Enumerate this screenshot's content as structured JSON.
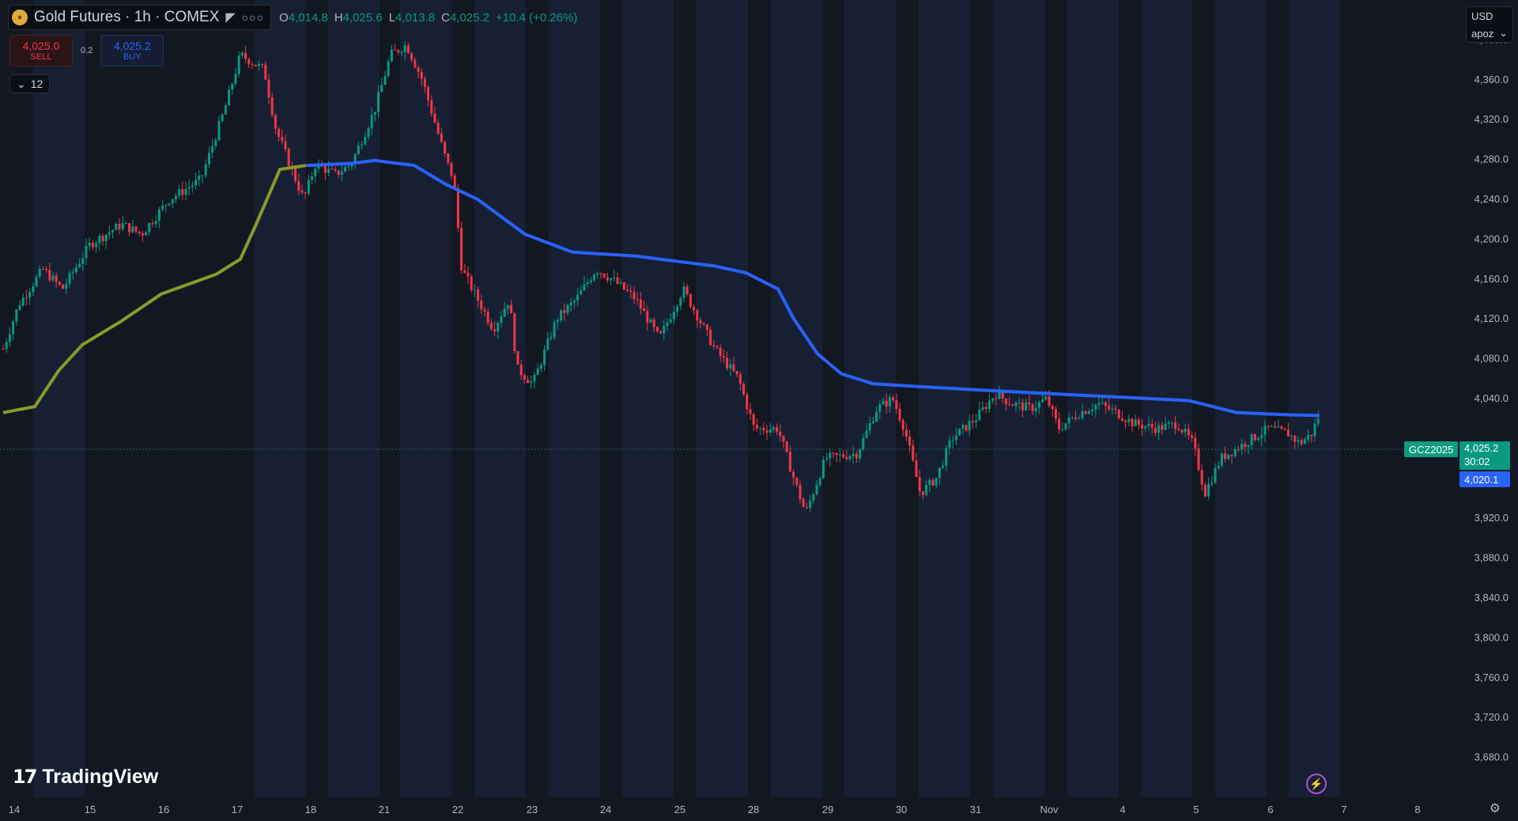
{
  "header": {
    "symbol_title": "Gold Futures · 1h · COMEX",
    "open_label": "O",
    "open": "4,014.8",
    "high_label": "H",
    "high": "4,025.6",
    "low_label": "L",
    "low": "4,013.8",
    "close_label": "C",
    "close": "4,025.2",
    "change": "+10.4 (+0.26%)"
  },
  "trade": {
    "sell_price": "4,025.0",
    "sell_label": "SELL",
    "spread": "0.2",
    "buy_price": "4,025.2",
    "buy_label": "BUY"
  },
  "indicator_toggle": "12",
  "top_right": {
    "currency": "USD",
    "user": "apoz"
  },
  "price_labels": {
    "symbol": "GCZ2025",
    "last_price": "4,025.2",
    "countdown": "30:02",
    "ma_value": "4,020.1"
  },
  "brand": "TradingView",
  "colors": {
    "background": "#131722",
    "session_band": "#172033",
    "up": "#089981",
    "down": "#f23645",
    "ma_slow": "#2962ff",
    "ma_fast": "#8a9a2a"
  },
  "chart_data": {
    "type": "candlestick",
    "interval": "1h",
    "ylim": [
      3640,
      4440
    ],
    "y_ticks": [
      4400,
      4360,
      4320,
      4280,
      4240,
      4200,
      4160,
      4120,
      4080,
      4040,
      3960,
      3920,
      3880,
      3840,
      3800,
      3760,
      3720,
      3680
    ],
    "y_tick_labels": [
      "4,400.0",
      "4,360.0",
      "4,320.0",
      "4,280.0",
      "4,240.0",
      "4,200.0",
      "4,160.0",
      "4,120.0",
      "4,080.0",
      "4,040.0",
      "3,960.0",
      "3,920.0",
      "3,880.0",
      "3,840.0",
      "3,800.0",
      "3,760.0",
      "3,720.0",
      "3,680.0"
    ],
    "x_tick_labels": [
      "14",
      "15",
      "16",
      "17",
      "18",
      "21",
      "22",
      "23",
      "24",
      "25",
      "28",
      "29",
      "30",
      "31",
      "Nov",
      "4",
      "5",
      "6",
      "7",
      "8"
    ],
    "last_price": 4025.2,
    "close_path": {
      "description": "approximate hourly close path read from chart",
      "points": [
        [
          0,
          4090
        ],
        [
          20,
          4135
        ],
        [
          50,
          4170
        ],
        [
          75,
          4150
        ],
        [
          110,
          4195
        ],
        [
          150,
          4215
        ],
        [
          175,
          4205
        ],
        [
          210,
          4240
        ],
        [
          250,
          4260
        ],
        [
          280,
          4330
        ],
        [
          300,
          4385
        ],
        [
          330,
          4370
        ],
        [
          345,
          4310
        ],
        [
          380,
          4240
        ],
        [
          395,
          4275
        ],
        [
          420,
          4265
        ],
        [
          440,
          4275
        ],
        [
          470,
          4330
        ],
        [
          490,
          4385
        ],
        [
          510,
          4395
        ],
        [
          530,
          4360
        ],
        [
          560,
          4280
        ],
        [
          570,
          4260
        ],
        [
          580,
          4170
        ],
        [
          600,
          4140
        ],
        [
          620,
          4110
        ],
        [
          640,
          4140
        ],
        [
          650,
          4070
        ],
        [
          670,
          4055
        ],
        [
          700,
          4120
        ],
        [
          725,
          4140
        ],
        [
          750,
          4170
        ],
        [
          770,
          4160
        ],
        [
          800,
          4140
        ],
        [
          830,
          4100
        ],
        [
          860,
          4150
        ],
        [
          880,
          4120
        ],
        [
          900,
          4090
        ],
        [
          930,
          4060
        ],
        [
          950,
          4010
        ],
        [
          980,
          4010
        ],
        [
          1000,
          3960
        ],
        [
          1015,
          3925
        ],
        [
          1040,
          3980
        ],
        [
          1080,
          3985
        ],
        [
          1105,
          4030
        ],
        [
          1125,
          4040
        ],
        [
          1140,
          4010
        ],
        [
          1160,
          3945
        ],
        [
          1180,
          3960
        ],
        [
          1200,
          4000
        ],
        [
          1230,
          4020
        ],
        [
          1255,
          4045
        ],
        [
          1275,
          4035
        ],
        [
          1300,
          4030
        ],
        [
          1320,
          4040
        ],
        [
          1335,
          4010
        ],
        [
          1360,
          4025
        ],
        [
          1385,
          4035
        ],
        [
          1410,
          4025
        ],
        [
          1430,
          4015
        ],
        [
          1460,
          4010
        ],
        [
          1485,
          4015
        ],
        [
          1505,
          3995
        ],
        [
          1520,
          3945
        ],
        [
          1540,
          3980
        ],
        [
          1570,
          3995
        ],
        [
          1600,
          4010
        ],
        [
          1625,
          4005
        ],
        [
          1640,
          3995
        ],
        [
          1655,
          4005
        ],
        [
          1665,
          4025
        ]
      ]
    },
    "series": [
      {
        "name": "",
        "color": "#2962ff",
        "points": [
          [
            383,
            4274
          ],
          [
            440,
            4276
          ],
          [
            470,
            4279
          ],
          [
            520,
            4274
          ],
          [
            560,
            4255
          ],
          [
            600,
            4240
          ],
          [
            660,
            4205
          ],
          [
            720,
            4187
          ],
          [
            800,
            4183
          ],
          [
            900,
            4173
          ],
          [
            940,
            4166
          ],
          [
            980,
            4150
          ],
          [
            1000,
            4120
          ],
          [
            1030,
            4085
          ],
          [
            1060,
            4065
          ],
          [
            1100,
            4055
          ],
          [
            1160,
            4052
          ],
          [
            1250,
            4048
          ],
          [
            1400,
            4042
          ],
          [
            1500,
            4038
          ],
          [
            1530,
            4032
          ],
          [
            1560,
            4026
          ],
          [
            1620,
            4024
          ],
          [
            1665,
            4023
          ]
        ]
      },
      {
        "name": "",
        "color": "#8a9a2a",
        "points": [
          [
            0,
            4026
          ],
          [
            40,
            4032
          ],
          [
            70,
            4068
          ],
          [
            100,
            4094
          ],
          [
            150,
            4118
          ],
          [
            200,
            4145
          ],
          [
            270,
            4165
          ],
          [
            300,
            4180
          ],
          [
            320,
            4215
          ],
          [
            350,
            4270
          ],
          [
            383,
            4274
          ]
        ]
      }
    ]
  }
}
